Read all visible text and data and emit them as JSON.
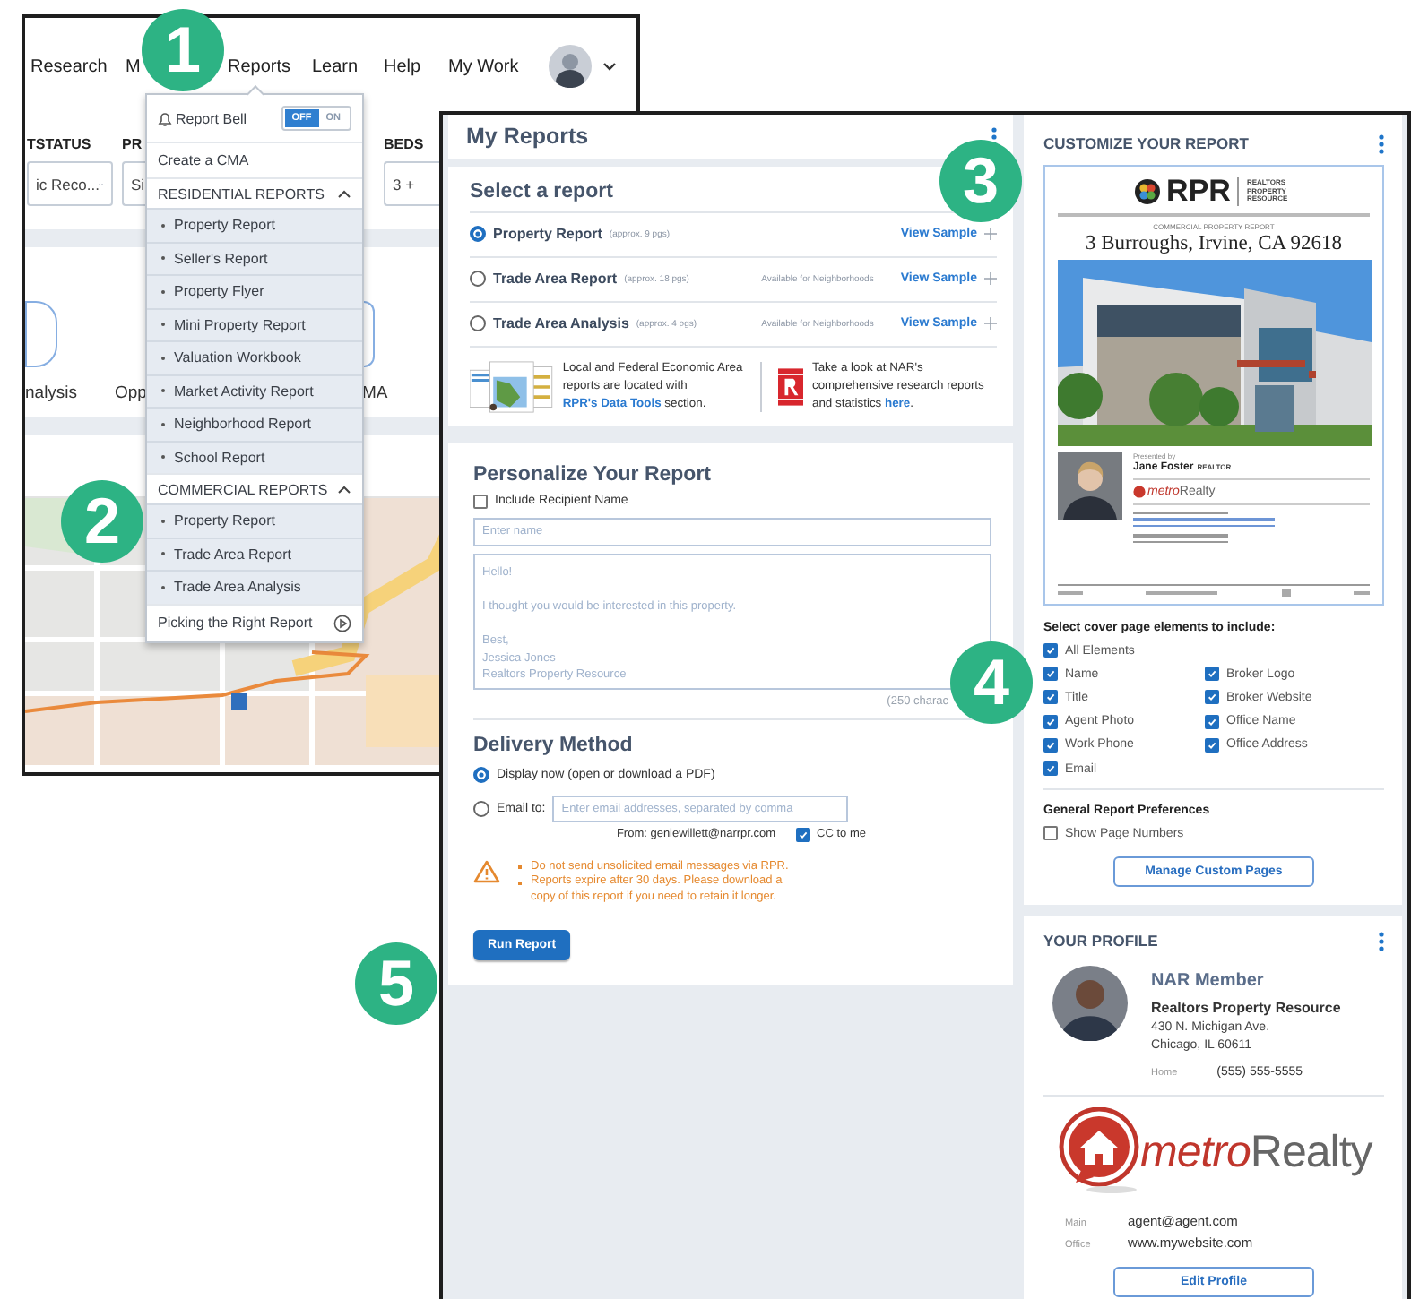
{
  "back_window": {
    "nav": [
      {
        "label": "Research"
      },
      {
        "label": "M"
      },
      {
        "label": "Reports"
      },
      {
        "label": "Learn"
      },
      {
        "label": "Help"
      },
      {
        "label": "My Work"
      }
    ],
    "filters": [
      {
        "label": "TSTATUS",
        "value": "ic Reco...",
        "dropdown": true
      },
      {
        "label": "PR",
        "value": "Si"
      },
      {
        "label": "BEDS",
        "value": "3 +"
      }
    ],
    "tools": [
      {
        "label": "nalysis",
        "icon": true
      },
      {
        "label": "Opp",
        "icon": false
      },
      {
        "label": "MA",
        "icon": true
      }
    ],
    "menu": {
      "report_bell": {
        "label": "Report Bell",
        "off_label": "OFF",
        "on_label": "ON",
        "on": false
      },
      "create_cma": "Create a CMA",
      "sections": [
        {
          "title": "RESIDENTIAL REPORTS",
          "expanded": true,
          "items": [
            "Property Report",
            "Seller's Report",
            "Property Flyer",
            "Mini Property Report",
            "Valuation Workbook",
            "Market Activity Report",
            "Neighborhood Report",
            "School Report"
          ]
        },
        {
          "title": "COMMERCIAL REPORTS",
          "expanded": true,
          "items": [
            "Property Report",
            "Trade Area Report",
            "Trade Area Analysis"
          ]
        }
      ],
      "footer": "Picking the Right Report"
    }
  },
  "front_window": {
    "header": {
      "title": "My Reports"
    },
    "select_report": {
      "title": "Select a report",
      "reports": [
        {
          "name": "Property Report",
          "pages": "(approx. 9 pgs)",
          "link": "View Sample",
          "selected": true
        },
        {
          "name": "Trade Area Report",
          "pages": "(approx. 18 pgs)",
          "note": "Available for Neighborhoods",
          "link": "View Sample",
          "selected": false
        },
        {
          "name": "Trade Area Analysis",
          "pages": "(approx. 4 pgs)",
          "note": "Available for Neighborhoods",
          "link": "View Sample",
          "selected": false
        }
      ],
      "info": [
        {
          "before": "Local and Federal Economic Area reports are located with",
          "link": "RPR's Data Tools",
          "after": "section."
        },
        {
          "before": "Take a look at NAR's comprehensive research reports and statistics",
          "link": "here",
          "after": "."
        }
      ]
    },
    "personalize": {
      "title": "Personalize Your Report",
      "include_recipient": {
        "label": "Include Recipient Name",
        "checked": false
      },
      "name_placeholder": "Enter name",
      "message_placeholder": "Hello!\n\nI thought you would be interested in this property.\n\nBest,\nJessica Jones\nRealtors Property Resource",
      "counter": "(250 charac"
    },
    "delivery": {
      "title": "Delivery Method",
      "options": [
        {
          "label": "Display now (open or download a PDF)",
          "selected": true
        },
        {
          "label": "Email to:",
          "selected": false
        }
      ],
      "email_placeholder": "Enter email addresses, separated by comma",
      "from": "From: geniewillett@narrpr.com",
      "cc": {
        "label": "CC to me",
        "checked": true
      }
    },
    "warnings": [
      "Do not send unsolicited email messages via RPR.",
      "Reports expire after 30 days. Please download a copy of this report if you need to retain it longer."
    ],
    "run_button": "Run Report",
    "customize": {
      "title": "CUSTOMIZE YOUR REPORT",
      "preview": {
        "brand": "RPR",
        "brand_tagline": "REALTORS PROPERTY RESOURCE",
        "report_kind": "COMMERCIAL PROPERTY REPORT",
        "address": "3 Burroughs, Irvine, CA 92618",
        "presented_by": "Presented by",
        "agent": "Jane Foster",
        "agent_title": "REALTOR",
        "broker": {
          "accent": "metro",
          "rest": "Realty"
        }
      },
      "elements_title": "Select cover page elements to include:",
      "all_elements": {
        "label": "All Elements",
        "checked": true
      },
      "elements": [
        {
          "label": "Name",
          "checked": true
        },
        {
          "label": "Broker Logo",
          "checked": true
        },
        {
          "label": "Title",
          "checked": true
        },
        {
          "label": "Broker Website",
          "checked": true
        },
        {
          "label": "Agent Photo",
          "checked": true
        },
        {
          "label": "Office Name",
          "checked": true
        },
        {
          "label": "Work Phone",
          "checked": true
        },
        {
          "label": "Office Address",
          "checked": true
        },
        {
          "label": "Email",
          "checked": true
        }
      ],
      "prefs_title": "General Report Preferences",
      "show_page_numbers": {
        "label": "Show Page Numbers",
        "checked": false
      },
      "manage_button": "Manage Custom Pages"
    },
    "profile": {
      "title": "YOUR PROFILE",
      "name": "NAR Member",
      "company": "Realtors Property Resource",
      "address": [
        "430 N. Michigan Ave.",
        "Chicago, IL 60611"
      ],
      "phone": {
        "label": "Home",
        "value": "(555) 555-5555"
      },
      "broker": {
        "accent": "metro",
        "rest": "Realty"
      },
      "contacts": [
        {
          "label": "Main",
          "value": "agent@agent.com"
        },
        {
          "label": "Office",
          "value": "www.mywebsite.com"
        }
      ],
      "button": "Edit Profile"
    }
  },
  "callouts": [
    "1",
    "2",
    "3",
    "4",
    "5"
  ]
}
